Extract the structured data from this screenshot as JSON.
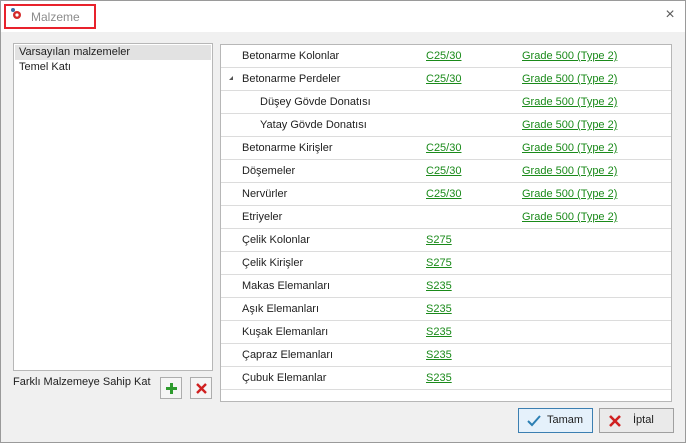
{
  "window": {
    "title": "Malzeme"
  },
  "left_panel": {
    "items": [
      "Varsayılan malzemeler",
      "Temel Katı"
    ],
    "footer_label": "Farklı Malzemeye Sahip Kat"
  },
  "grid": {
    "rows": [
      {
        "name": "Betonarme Kolonlar",
        "concrete": "C25/30",
        "steel": "Grade 500 (Type 2)"
      },
      {
        "name": "Betonarme Perdeler",
        "concrete": "C25/30",
        "steel": "Grade 500 (Type 2)"
      },
      {
        "name": "Düşey Gövde Donatısı",
        "concrete": "",
        "steel": "Grade 500 (Type 2)"
      },
      {
        "name": "Yatay Gövde Donatısı",
        "concrete": "",
        "steel": "Grade 500 (Type 2)"
      },
      {
        "name": "Betonarme Kirişler",
        "concrete": "C25/30",
        "steel": "Grade 500 (Type 2)"
      },
      {
        "name": "Döşemeler",
        "concrete": "C25/30",
        "steel": "Grade 500 (Type 2)"
      },
      {
        "name": "Nervürler",
        "concrete": "C25/30",
        "steel": "Grade 500 (Type 2)"
      },
      {
        "name": "Etriyeler",
        "concrete": "",
        "steel": "Grade 500 (Type 2)"
      },
      {
        "name": "Çelik Kolonlar",
        "concrete": "S275",
        "steel": ""
      },
      {
        "name": "Çelik Kirişler",
        "concrete": "S275",
        "steel": ""
      },
      {
        "name": "Makas Elemanları",
        "concrete": "S235",
        "steel": ""
      },
      {
        "name": "Aşık Elemanları",
        "concrete": "S235",
        "steel": ""
      },
      {
        "name": "Kuşak Elemanları",
        "concrete": "S235",
        "steel": ""
      },
      {
        "name": "Çapraz Elemanları",
        "concrete": "S235",
        "steel": ""
      },
      {
        "name": "Çubuk Elemanlar",
        "concrete": "S235",
        "steel": ""
      }
    ]
  },
  "buttons": {
    "ok": "Tamam",
    "cancel": "İptal"
  },
  "colors": {
    "link": "#1a8a1a",
    "highlight": "#e8222c"
  }
}
